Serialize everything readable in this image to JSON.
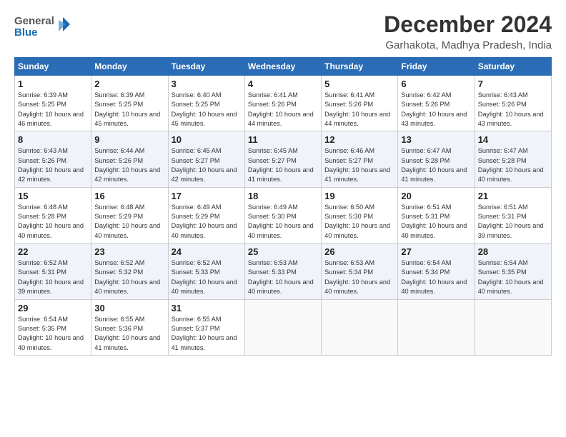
{
  "header": {
    "logo_general": "General",
    "logo_blue": "Blue",
    "month_title": "December 2024",
    "location": "Garhakota, Madhya Pradesh, India"
  },
  "days_of_week": [
    "Sunday",
    "Monday",
    "Tuesday",
    "Wednesday",
    "Thursday",
    "Friday",
    "Saturday"
  ],
  "weeks": [
    [
      {
        "day": "1",
        "sunrise": "6:39 AM",
        "sunset": "5:25 PM",
        "daylight": "10 hours and 46 minutes."
      },
      {
        "day": "2",
        "sunrise": "6:39 AM",
        "sunset": "5:25 PM",
        "daylight": "10 hours and 45 minutes."
      },
      {
        "day": "3",
        "sunrise": "6:40 AM",
        "sunset": "5:25 PM",
        "daylight": "10 hours and 45 minutes."
      },
      {
        "day": "4",
        "sunrise": "6:41 AM",
        "sunset": "5:26 PM",
        "daylight": "10 hours and 44 minutes."
      },
      {
        "day": "5",
        "sunrise": "6:41 AM",
        "sunset": "5:26 PM",
        "daylight": "10 hours and 44 minutes."
      },
      {
        "day": "6",
        "sunrise": "6:42 AM",
        "sunset": "5:26 PM",
        "daylight": "10 hours and 43 minutes."
      },
      {
        "day": "7",
        "sunrise": "6:43 AM",
        "sunset": "5:26 PM",
        "daylight": "10 hours and 43 minutes."
      }
    ],
    [
      {
        "day": "8",
        "sunrise": "6:43 AM",
        "sunset": "5:26 PM",
        "daylight": "10 hours and 42 minutes."
      },
      {
        "day": "9",
        "sunrise": "6:44 AM",
        "sunset": "5:26 PM",
        "daylight": "10 hours and 42 minutes."
      },
      {
        "day": "10",
        "sunrise": "6:45 AM",
        "sunset": "5:27 PM",
        "daylight": "10 hours and 42 minutes."
      },
      {
        "day": "11",
        "sunrise": "6:45 AM",
        "sunset": "5:27 PM",
        "daylight": "10 hours and 41 minutes."
      },
      {
        "day": "12",
        "sunrise": "6:46 AM",
        "sunset": "5:27 PM",
        "daylight": "10 hours and 41 minutes."
      },
      {
        "day": "13",
        "sunrise": "6:47 AM",
        "sunset": "5:28 PM",
        "daylight": "10 hours and 41 minutes."
      },
      {
        "day": "14",
        "sunrise": "6:47 AM",
        "sunset": "5:28 PM",
        "daylight": "10 hours and 40 minutes."
      }
    ],
    [
      {
        "day": "15",
        "sunrise": "6:48 AM",
        "sunset": "5:28 PM",
        "daylight": "10 hours and 40 minutes."
      },
      {
        "day": "16",
        "sunrise": "6:48 AM",
        "sunset": "5:29 PM",
        "daylight": "10 hours and 40 minutes."
      },
      {
        "day": "17",
        "sunrise": "6:49 AM",
        "sunset": "5:29 PM",
        "daylight": "10 hours and 40 minutes."
      },
      {
        "day": "18",
        "sunrise": "6:49 AM",
        "sunset": "5:30 PM",
        "daylight": "10 hours and 40 minutes."
      },
      {
        "day": "19",
        "sunrise": "6:50 AM",
        "sunset": "5:30 PM",
        "daylight": "10 hours and 40 minutes."
      },
      {
        "day": "20",
        "sunrise": "6:51 AM",
        "sunset": "5:31 PM",
        "daylight": "10 hours and 40 minutes."
      },
      {
        "day": "21",
        "sunrise": "6:51 AM",
        "sunset": "5:31 PM",
        "daylight": "10 hours and 39 minutes."
      }
    ],
    [
      {
        "day": "22",
        "sunrise": "6:52 AM",
        "sunset": "5:31 PM",
        "daylight": "10 hours and 39 minutes."
      },
      {
        "day": "23",
        "sunrise": "6:52 AM",
        "sunset": "5:32 PM",
        "daylight": "10 hours and 40 minutes."
      },
      {
        "day": "24",
        "sunrise": "6:52 AM",
        "sunset": "5:33 PM",
        "daylight": "10 hours and 40 minutes."
      },
      {
        "day": "25",
        "sunrise": "6:53 AM",
        "sunset": "5:33 PM",
        "daylight": "10 hours and 40 minutes."
      },
      {
        "day": "26",
        "sunrise": "6:53 AM",
        "sunset": "5:34 PM",
        "daylight": "10 hours and 40 minutes."
      },
      {
        "day": "27",
        "sunrise": "6:54 AM",
        "sunset": "5:34 PM",
        "daylight": "10 hours and 40 minutes."
      },
      {
        "day": "28",
        "sunrise": "6:54 AM",
        "sunset": "5:35 PM",
        "daylight": "10 hours and 40 minutes."
      }
    ],
    [
      {
        "day": "29",
        "sunrise": "6:54 AM",
        "sunset": "5:35 PM",
        "daylight": "10 hours and 40 minutes."
      },
      {
        "day": "30",
        "sunrise": "6:55 AM",
        "sunset": "5:36 PM",
        "daylight": "10 hours and 41 minutes."
      },
      {
        "day": "31",
        "sunrise": "6:55 AM",
        "sunset": "5:37 PM",
        "daylight": "10 hours and 41 minutes."
      },
      null,
      null,
      null,
      null
    ]
  ]
}
